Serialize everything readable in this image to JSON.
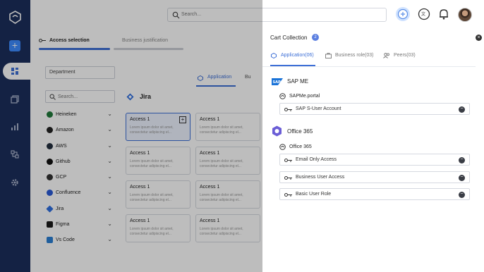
{
  "topbar": {
    "search_placeholder": "Search..."
  },
  "page": {
    "steps": [
      "Access selection",
      "Business justification"
    ],
    "department_label": "Department",
    "tabs": [
      "Application",
      "Bu"
    ],
    "side_search_placeholder": "Search...",
    "apps": [
      "Heineken",
      "Amazon",
      "AWS",
      "Github",
      "GCP",
      "Confluence",
      "Jira",
      "Figma",
      "Vs Code"
    ],
    "section_title": "Jira",
    "cards": [
      {
        "title": "Access 1",
        "desc": "Lorem ipsum dolor sit amet, consectetur adipiscing el..."
      },
      {
        "title": "Access 1",
        "desc": "Lorem ipsum dolor sit amet, consectetur adipiscing el..."
      },
      {
        "title": "Access 1",
        "desc": "Lorem ipsum dolor sit amet, consectetur adipiscing el..."
      },
      {
        "title": "Access 1",
        "desc": "Lorem ipsum dolor sit amet, consectetur adipiscing el..."
      },
      {
        "title": "Access 1",
        "desc": "Lorem ipsum dolor sit amet, consectetur adipiscing el..."
      },
      {
        "title": "Access 1",
        "desc": "Lorem ipsum dolor sit amet, consectetur adipiscing el..."
      },
      {
        "title": "Access 1",
        "desc": "Lorem ipsum dolor sit amet, consectetur adipiscing el..."
      },
      {
        "title": "Access 1",
        "desc": "Lorem ipsum dolor sit amet, consectetur adipiscing el..."
      }
    ]
  },
  "cart": {
    "title": "Cart Collection",
    "count": "2",
    "tabs": [
      "Application(06)",
      "Business role(03)",
      "Peers(03)"
    ],
    "groups": [
      {
        "app": "SAP ME",
        "portal": "SAPMe.portal",
        "accounts": [
          "SAP S-User Account"
        ]
      },
      {
        "app": "Office 365",
        "portal": "Office 365",
        "accounts": [
          "Email Only Access",
          "Business User Access",
          "Basic User Role"
        ]
      }
    ]
  },
  "colors": {
    "rail": "#1c2e5c",
    "accent": "#3d6fd6",
    "add_button": "#3d8bff"
  }
}
